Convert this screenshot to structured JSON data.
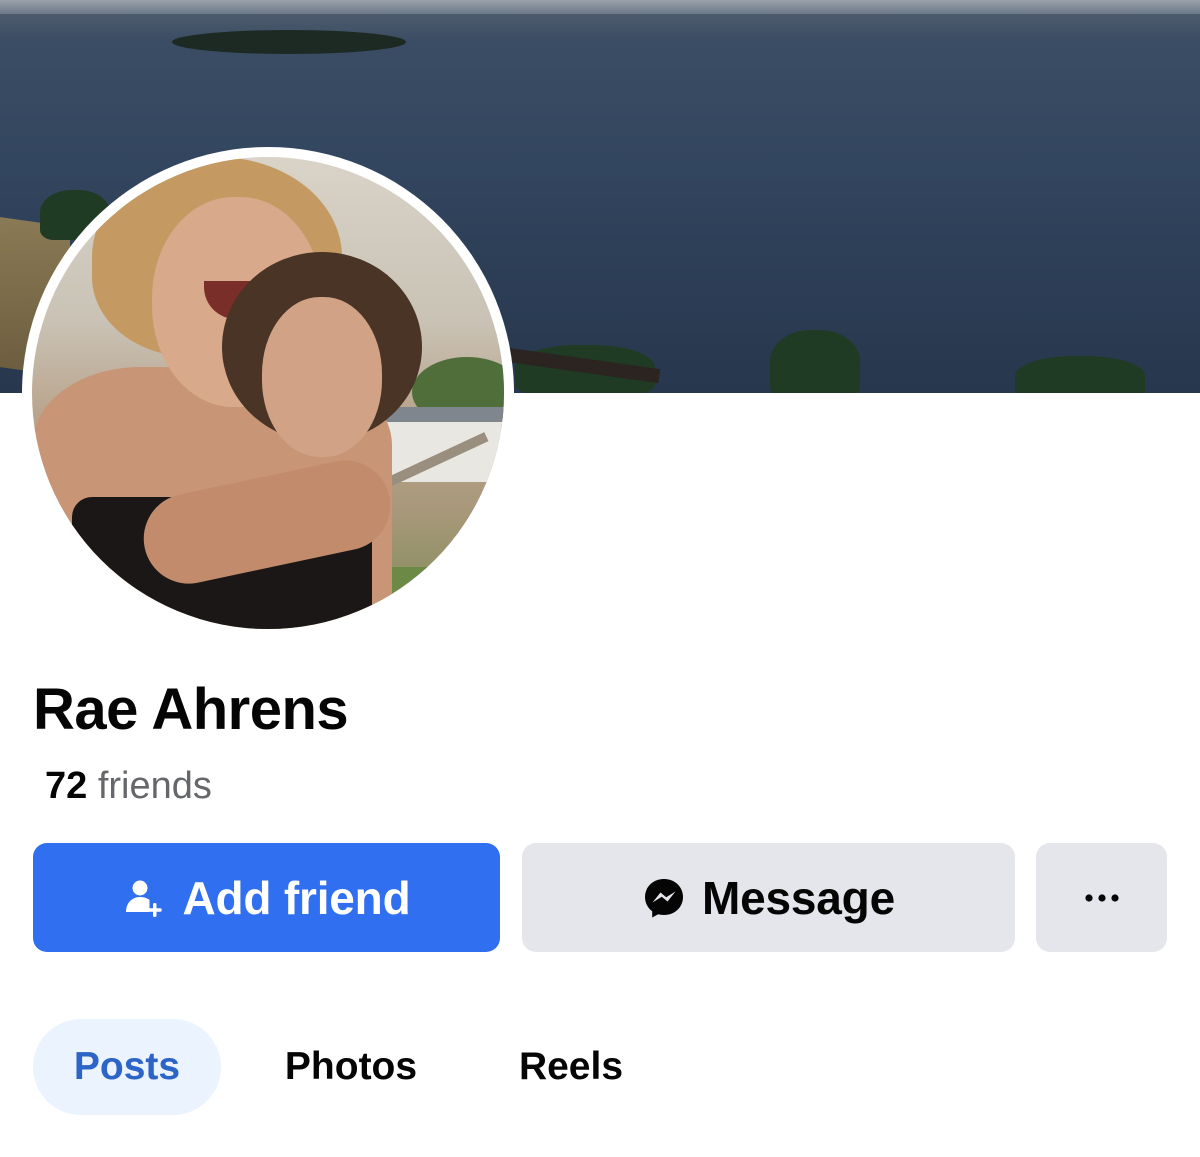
{
  "profile": {
    "name": "Rae Ahrens",
    "friends_count": "72",
    "friends_label": "friends"
  },
  "actions": {
    "add_friend_label": "Add friend",
    "message_label": "Message",
    "more_icon": "ellipsis-icon"
  },
  "tabs": [
    {
      "label": "Posts",
      "active": true
    },
    {
      "label": "Photos",
      "active": false
    },
    {
      "label": "Reels",
      "active": false
    }
  ],
  "colors": {
    "primary_blue": "#2f6ff0",
    "active_tab_bg": "#ebf3fe",
    "active_tab_text": "#2d64c8",
    "secondary_button_bg": "#e4e6eb",
    "muted_text": "#65676b"
  }
}
